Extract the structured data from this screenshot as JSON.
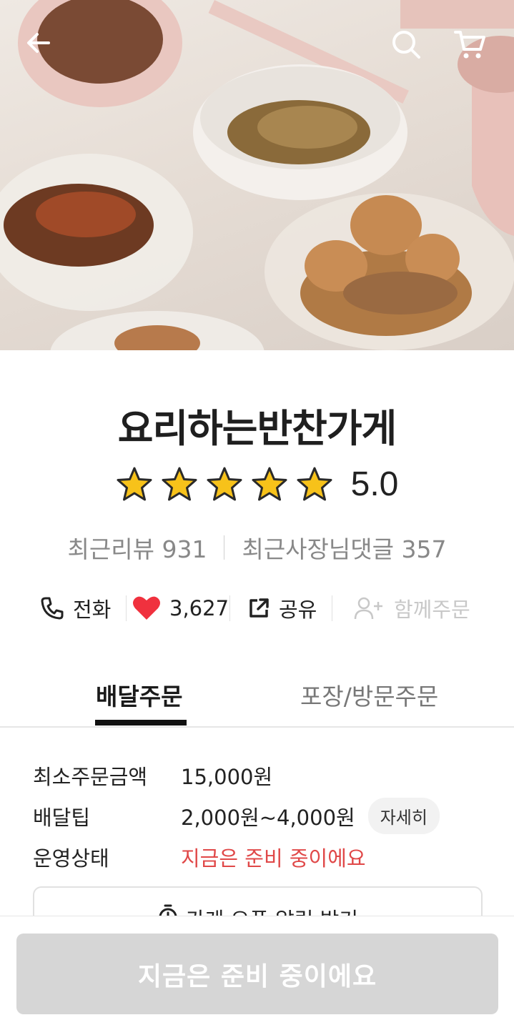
{
  "store": {
    "name": "요리하는반찬가게",
    "rating": "5.0",
    "stars": 5,
    "recent_reviews": "최근리뷰 931",
    "owner_replies": "최근사장님댓글 357"
  },
  "actions": {
    "call": "전화",
    "likes": "3,627",
    "share": "공유",
    "group_order": "함께주문"
  },
  "tabs": {
    "delivery": "배달주문",
    "pickup": "포장/방문주문"
  },
  "info": {
    "min_order_label": "최소주문금액",
    "min_order_value": "15,000원",
    "tip_label": "배달팁",
    "tip_value": "2,000원~4,000원",
    "detail_chip": "자세히",
    "status_label": "운영상태",
    "status_value": "지금은 준비 중이에요"
  },
  "notify_button": "가게 오픈 알림 받기",
  "cta": "지금은 준비 중이에요",
  "icons": [
    "back-arrow-icon",
    "search-icon",
    "cart-icon",
    "phone-icon",
    "heart-icon",
    "share-icon",
    "add-person-icon",
    "alarm-clock-icon",
    "star-icon"
  ],
  "colors": {
    "accent_red": "#e04848",
    "heart": "#f0313e",
    "cta_disabled": "#d6d6d6"
  }
}
